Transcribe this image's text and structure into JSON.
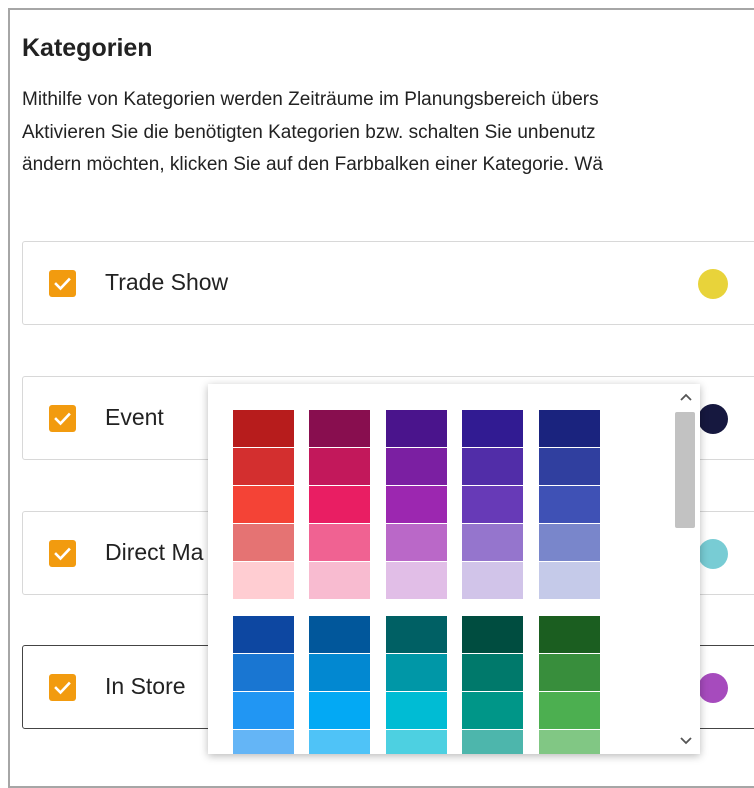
{
  "title": "Kategorien",
  "description": [
    "Mithilfe von Kategorien werden Zeiträume im Planungsbereich übers",
    "Aktivieren Sie die benötigten Kategorien bzw. schalten Sie unbenutz",
    "ändern möchten, klicken Sie auf den Farbbalken einer Kategorie. Wä"
  ],
  "categories": [
    {
      "label": "Trade Show",
      "checked": true,
      "color": "#e8d33a"
    },
    {
      "label": "Event",
      "checked": true,
      "color": "#16183f"
    },
    {
      "label": "Direct Ma",
      "checked": true,
      "color": "#78ccd4"
    },
    {
      "label": "In Store",
      "checked": true,
      "color": "#a64bbd"
    }
  ],
  "palette": {
    "icons": {
      "scroll_up": "chevron-up-icon",
      "scroll_down": "chevron-down-icon",
      "check": "check-icon"
    },
    "groups": [
      [
        [
          "#b71c1c",
          "#d32f2f",
          "#f44336",
          "#e57373",
          "#ffcdd2"
        ],
        [
          "#880e4f",
          "#c2185b",
          "#e91e63",
          "#f06292",
          "#f8bbd0"
        ],
        [
          "#4a148c",
          "#7b1fa2",
          "#9c27b0",
          "#ba68c8",
          "#e1bee7"
        ],
        [
          "#311b92",
          "#512da8",
          "#673ab7",
          "#9575cd",
          "#d1c4e9"
        ],
        [
          "#1a237e",
          "#303f9f",
          "#3f51b5",
          "#7986cb",
          "#c5cae9"
        ]
      ],
      [
        [
          "#0d47a1",
          "#1976d2",
          "#2196f3",
          "#64b5f6"
        ],
        [
          "#01579b",
          "#0288d1",
          "#03a9f4",
          "#4fc3f7"
        ],
        [
          "#006064",
          "#0097a7",
          "#00bcd4",
          "#4dd0e1"
        ],
        [
          "#004d40",
          "#00796b",
          "#009688",
          "#4db6ac"
        ],
        [
          "#1b5e20",
          "#388e3c",
          "#4caf50",
          "#81c784"
        ]
      ]
    ]
  }
}
